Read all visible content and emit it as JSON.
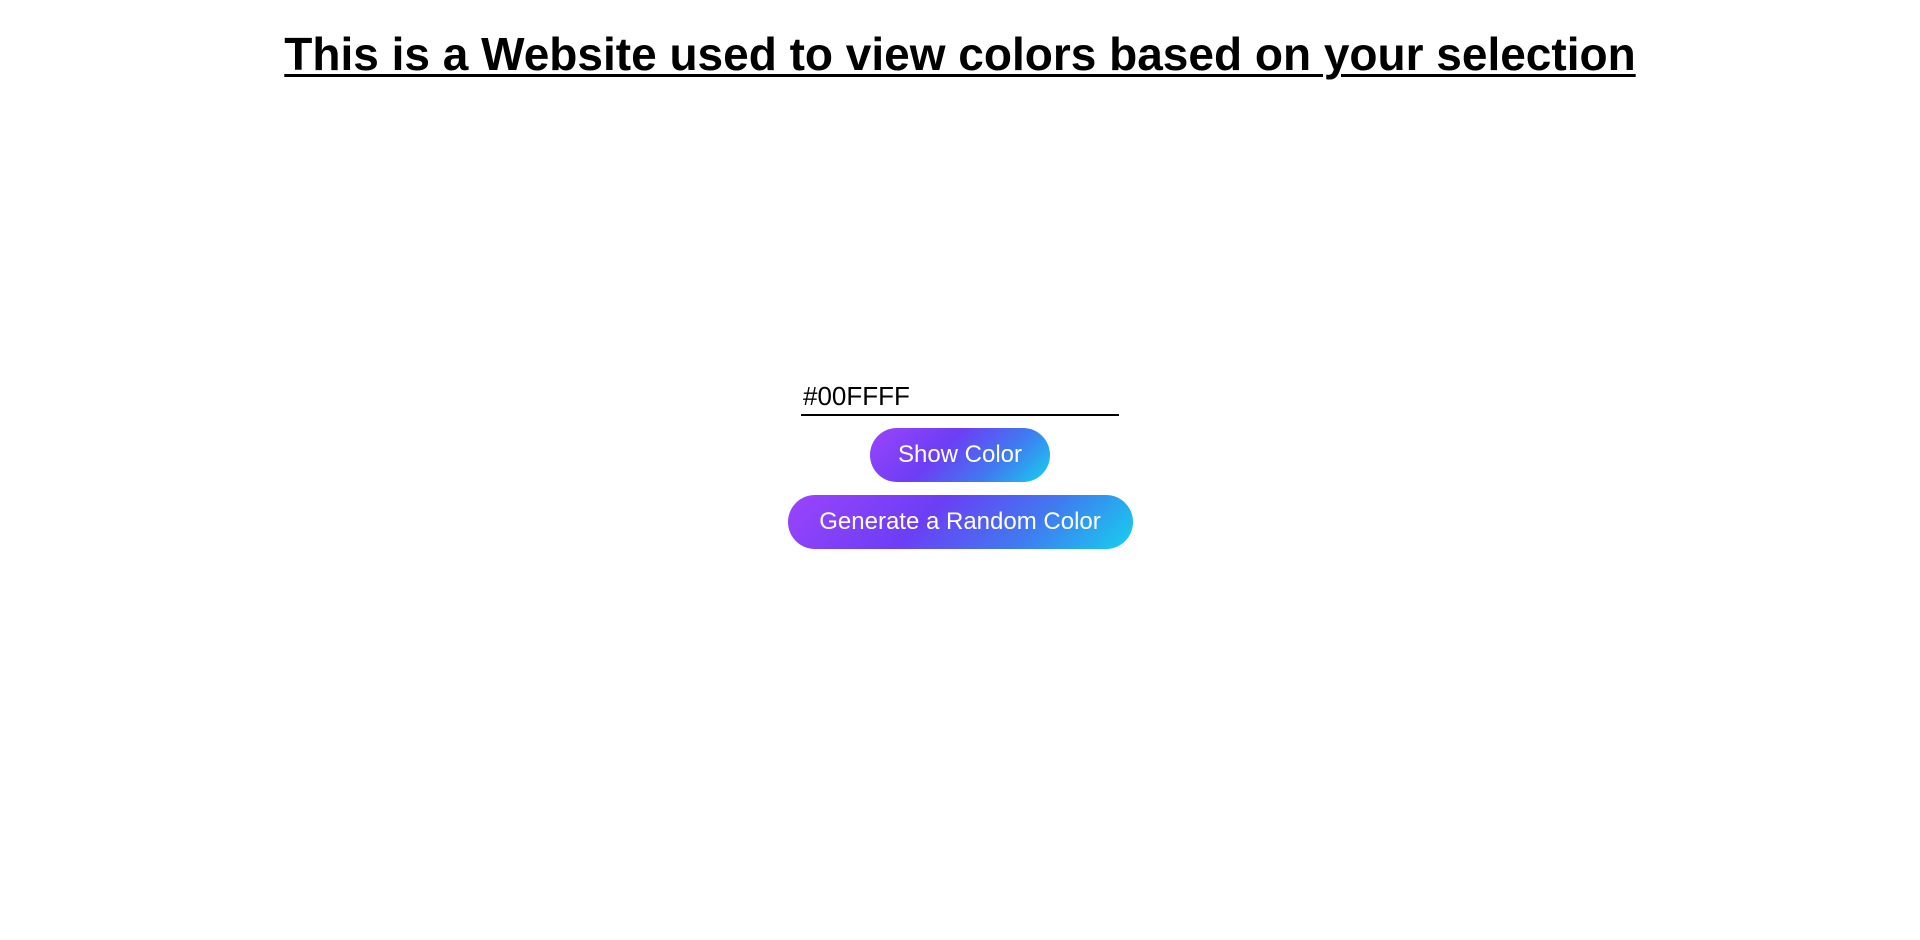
{
  "page": {
    "heading": "This is a Website used to view colors based on your selection"
  },
  "form": {
    "color_input_value": "#00FFFF",
    "show_color_label": "Show Color",
    "random_color_label": "Generate a Random Color"
  },
  "colors": {
    "button_gradient_start": "#9b44fb",
    "button_gradient_mid": "#3f7bf0",
    "button_gradient_end": "#16d1ee",
    "text": "#000000",
    "background": "#ffffff"
  }
}
